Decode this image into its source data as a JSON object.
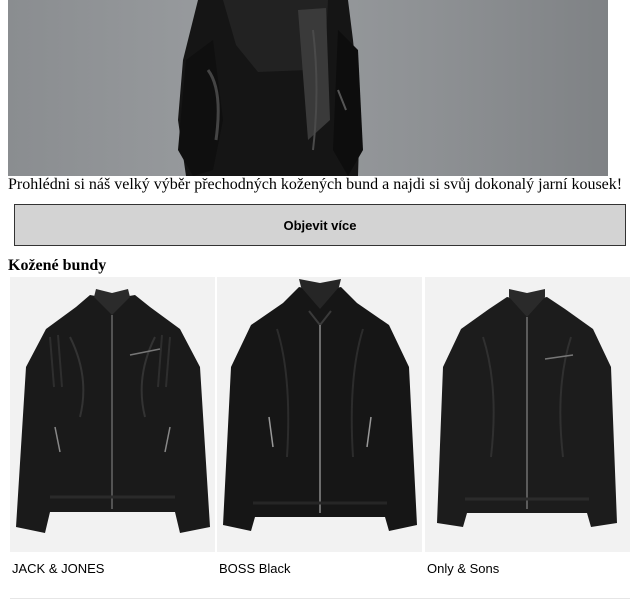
{
  "hero": {
    "image_alt": "model wearing black leather jacket"
  },
  "intro": {
    "text": "Prohlédni si náš velký výběr přechodných kožených bund a najdi si svůj dokonalý jarní kousek!"
  },
  "cta": {
    "label": "Objevit více"
  },
  "section": {
    "title": "Kožené bundy"
  },
  "products": [
    {
      "brand": "JACK & JONES",
      "image": "black-leather-biker-jacket-icon"
    },
    {
      "brand": "BOSS Black",
      "image": "black-leather-jacket-icon"
    },
    {
      "brand": "Only & Sons",
      "image": "black-leather-jacket-icon"
    }
  ],
  "colors": {
    "button_bg": "#d3d3d3",
    "thumb_bg": "#f2f2f2",
    "jacket": "#1a1a1a"
  }
}
